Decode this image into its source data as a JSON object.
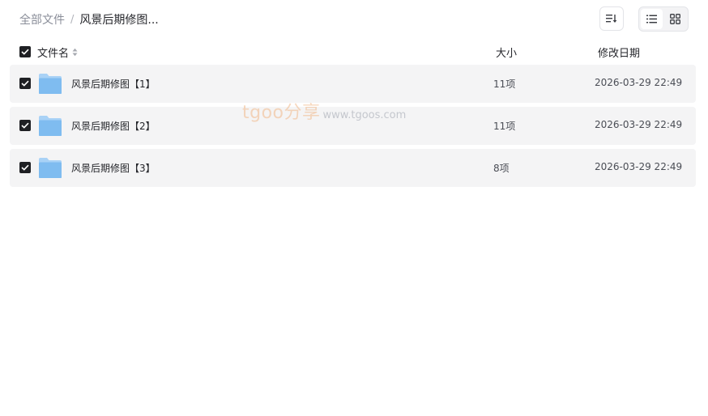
{
  "breadcrumb": {
    "root": "全部文件",
    "separator": "/",
    "current": "风景后期修图..."
  },
  "toolbar": {
    "sort_icon": "sort-icon",
    "list_view_icon": "list-view-icon",
    "grid_view_icon": "grid-view-icon",
    "active_view": "list"
  },
  "header": {
    "name": "文件名",
    "size": "大小",
    "date": "修改日期"
  },
  "rows": [
    {
      "name": "风景后期修图【1】",
      "count": "11项",
      "date": "2026-03-29 22:49"
    },
    {
      "name": "风景后期修图【2】",
      "count": "11项",
      "date": "2026-03-29 22:49"
    },
    {
      "name": "风景后期修图【3】",
      "count": "8项",
      "date": "2026-03-29 22:49"
    }
  ],
  "watermark": {
    "brand": "tgoo分享",
    "url": "www.tgoos.com"
  },
  "colors": {
    "row_bg": "#f4f4f5",
    "checkbox": "#1f2024",
    "folder": "#7fbcf0"
  }
}
